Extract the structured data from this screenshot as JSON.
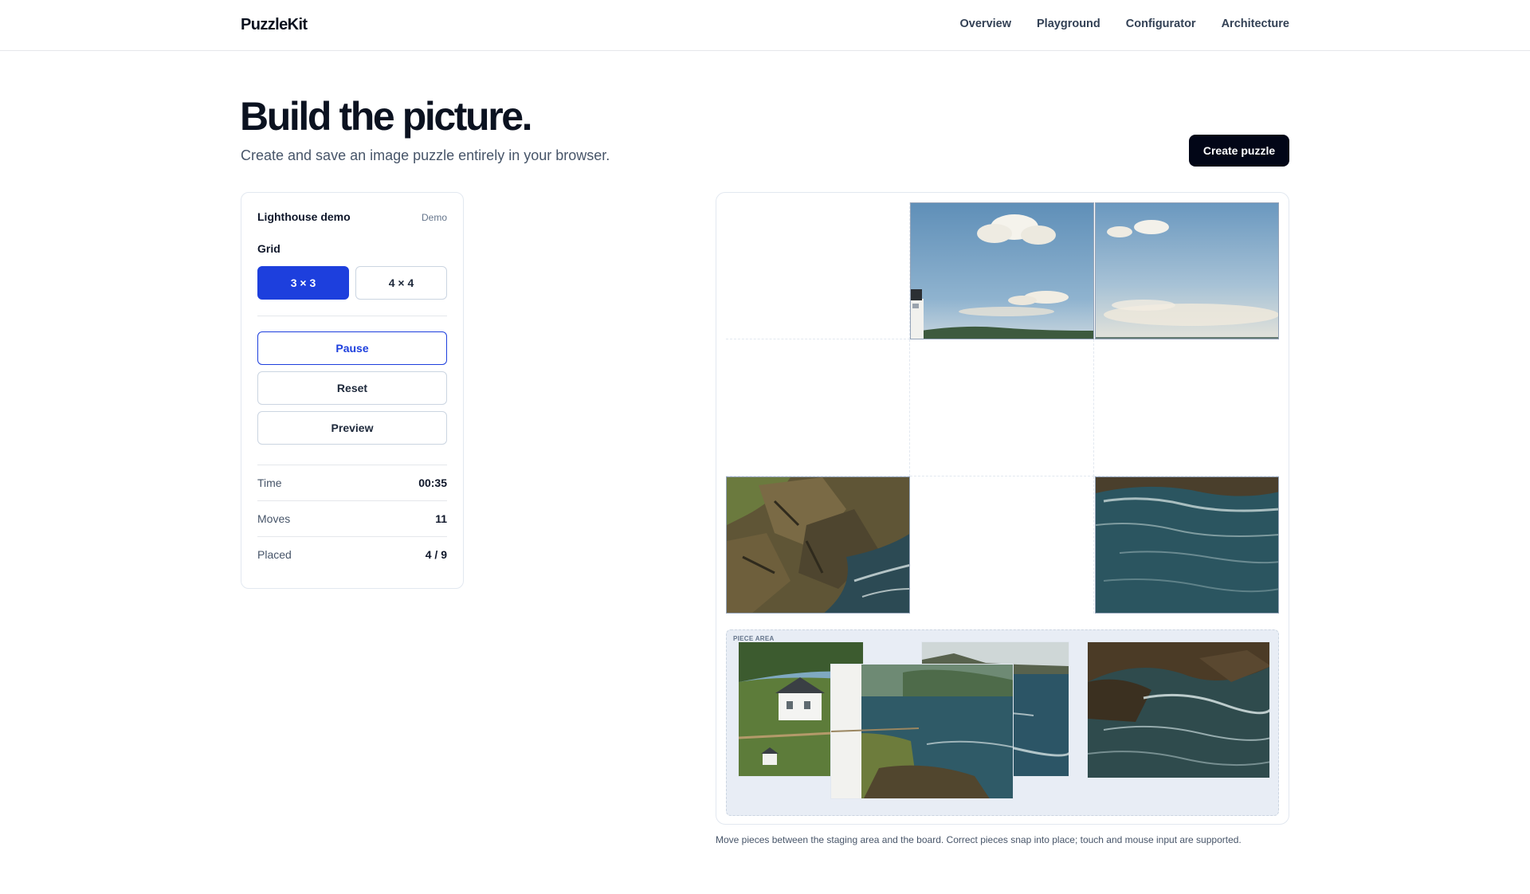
{
  "header": {
    "brand": "PuzzleKit",
    "nav": [
      "Overview",
      "Playground",
      "Configurator",
      "Architecture"
    ]
  },
  "hero": {
    "title": "Build the picture.",
    "subtitle": "Create and save an image puzzle entirely in your browser.",
    "cta": "Create puzzle"
  },
  "panel": {
    "title": "Lighthouse demo",
    "badge": "Demo",
    "grid_label": "Grid",
    "grid_options": [
      "3 × 3",
      "4 × 4"
    ],
    "grid_selected": "3 × 3",
    "actions": [
      "Pause",
      "Reset",
      "Preview"
    ],
    "stats": [
      {
        "label": "Time",
        "value": "00:35"
      },
      {
        "label": "Moves",
        "value": "11"
      },
      {
        "label": "Placed",
        "value": "4 / 9"
      }
    ]
  },
  "board": {
    "staging_label": "PIECE AREA",
    "placed_tiles": [
      "sky-lighthouse-top",
      "sky-clouds-right",
      "rocky-shore-left",
      "sea-waves-right"
    ],
    "caption": "Move pieces between the staging area and the board. Correct pieces snap into place; touch and mouse input are supported."
  },
  "colors": {
    "accent": "#1d3fdd",
    "cta_bg": "#020617",
    "staging_bg": "#e8edf5"
  }
}
